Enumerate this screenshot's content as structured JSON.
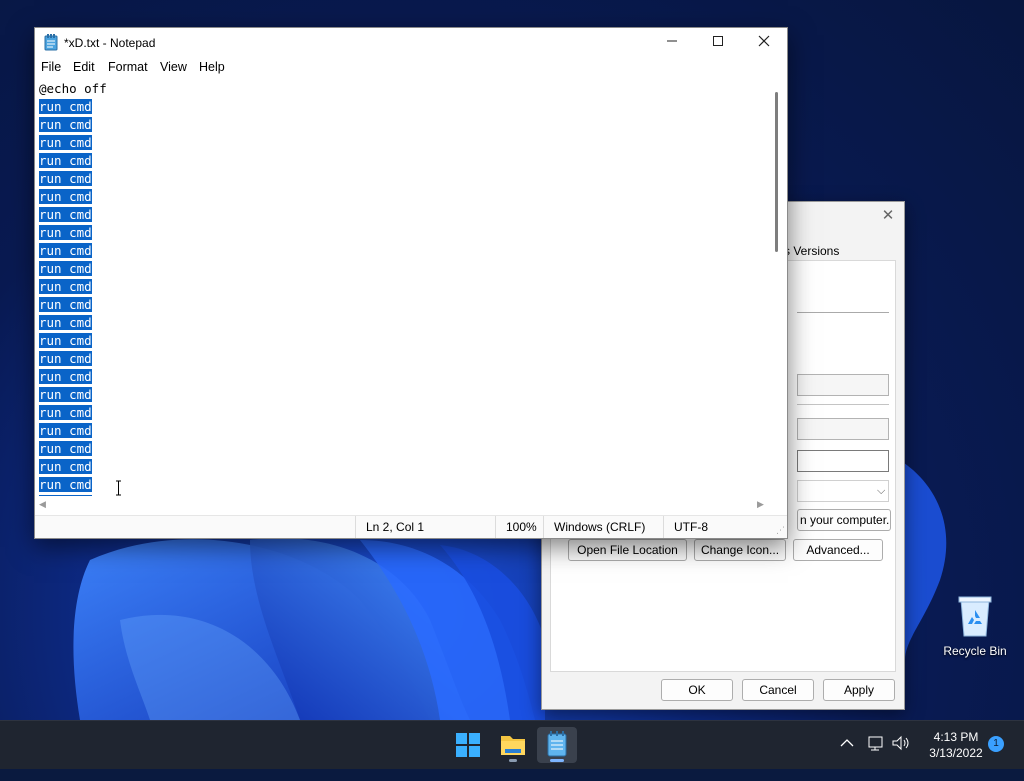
{
  "notepad": {
    "title": "*xD.txt - Notepad",
    "menu": [
      "File",
      "Edit",
      "Format",
      "View",
      "Help"
    ],
    "lines": [
      {
        "text": "@echo off",
        "selected": false
      },
      {
        "text": "run cmd",
        "selected": true
      },
      {
        "text": "run cmd",
        "selected": true
      },
      {
        "text": "run cmd",
        "selected": true
      },
      {
        "text": "run cmd",
        "selected": true
      },
      {
        "text": "run cmd",
        "selected": true
      },
      {
        "text": "run cmd",
        "selected": true
      },
      {
        "text": "run cmd",
        "selected": true
      },
      {
        "text": "run cmd",
        "selected": true
      },
      {
        "text": "run cmd",
        "selected": true
      },
      {
        "text": "run cmd",
        "selected": true
      },
      {
        "text": "run cmd",
        "selected": true
      },
      {
        "text": "run cmd",
        "selected": true
      },
      {
        "text": "run cmd",
        "selected": true
      },
      {
        "text": "run cmd",
        "selected": true
      },
      {
        "text": "run cmd",
        "selected": true
      },
      {
        "text": "run cmd",
        "selected": true
      },
      {
        "text": "run cmd",
        "selected": true
      },
      {
        "text": "run cmd",
        "selected": true
      },
      {
        "text": "run cmd",
        "selected": true
      },
      {
        "text": "run cmd",
        "selected": true
      },
      {
        "text": "run cmd",
        "selected": true
      },
      {
        "text": "run cmd",
        "selected": true
      },
      {
        "text": "run cmd",
        "selected": true
      }
    ],
    "status": {
      "position": "Ln 2, Col 1",
      "zoom": "100%",
      "line_endings": "Windows (CRLF)",
      "encoding": "UTF-8"
    }
  },
  "properties_dialog": {
    "tab_partial": "s Versions",
    "target_text_partial": "n your computer.",
    "buttons": {
      "open_file_location": "Open File Location",
      "change_icon": "Change Icon...",
      "advanced": "Advanced...",
      "ok": "OK",
      "cancel": "Cancel",
      "apply": "Apply"
    }
  },
  "desktop": {
    "recycle_bin_label": "Recycle Bin"
  },
  "taskbar": {
    "time": "4:13 PM",
    "date": "3/13/2022",
    "notification_count": "1"
  },
  "colors": {
    "selection": "#0a64c8",
    "taskbar": "#1f2530",
    "accent": "#3aa0ff"
  }
}
